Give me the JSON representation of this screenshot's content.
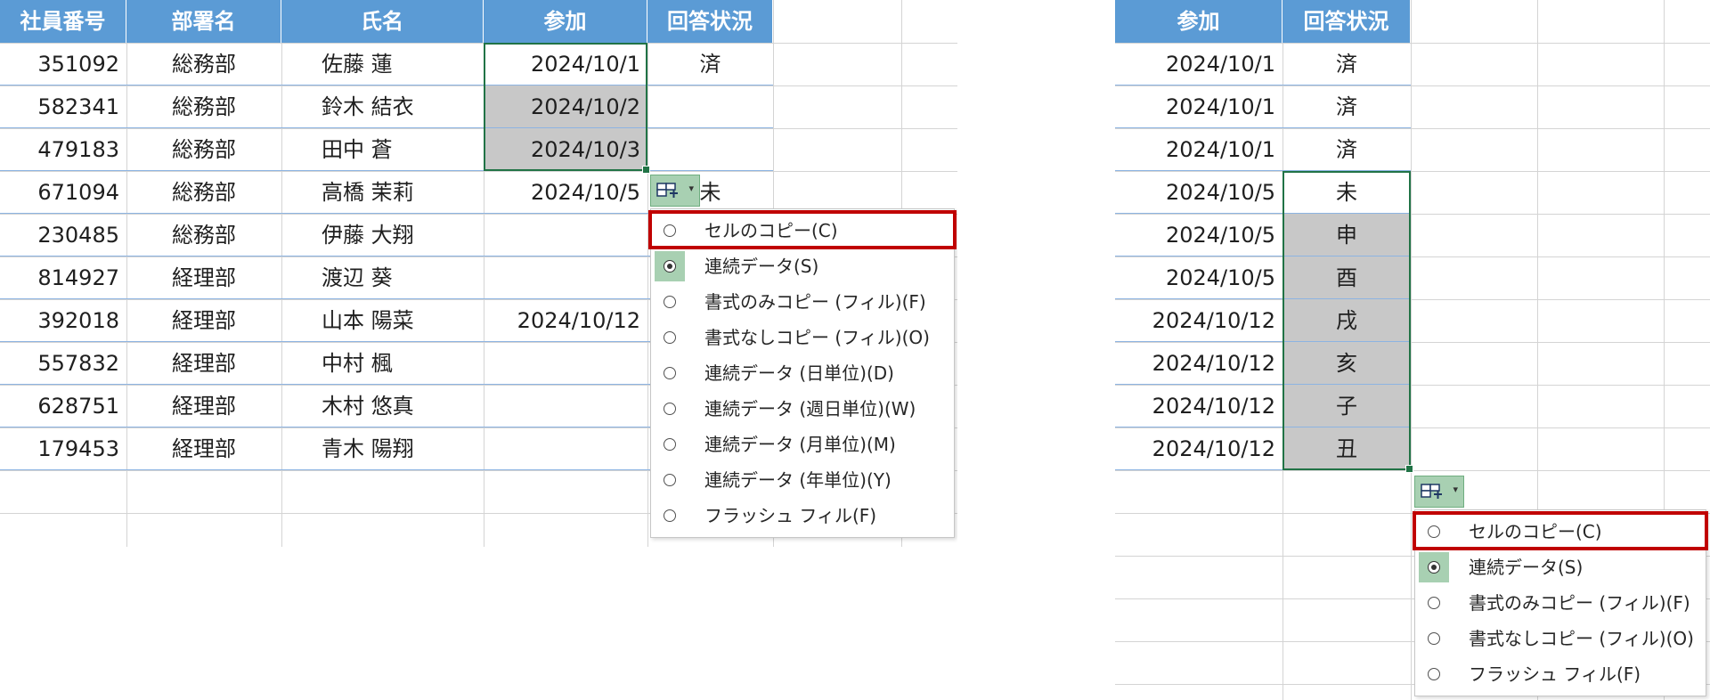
{
  "left_table": {
    "headers": [
      "社員番号",
      "部署名",
      "氏名",
      "参加",
      "回答状況"
    ],
    "rows": [
      [
        "351092",
        "総務部",
        "佐藤 蓮",
        "2024/10/1",
        "済"
      ],
      [
        "582341",
        "総務部",
        "鈴木 結衣",
        "2024/10/2",
        ""
      ],
      [
        "479183",
        "総務部",
        "田中 蒼",
        "2024/10/3",
        ""
      ],
      [
        "671094",
        "総務部",
        "高橋 茉莉",
        "2024/10/5",
        "未"
      ],
      [
        "230485",
        "総務部",
        "伊藤 大翔",
        "",
        ""
      ],
      [
        "814927",
        "経理部",
        "渡辺 葵",
        "",
        ""
      ],
      [
        "392018",
        "経理部",
        "山本 陽菜",
        "2024/10/12",
        ""
      ],
      [
        "557832",
        "経理部",
        "中村 楓",
        "",
        ""
      ],
      [
        "628751",
        "経理部",
        "木村 悠真",
        "",
        ""
      ],
      [
        "179453",
        "経理部",
        "青木 陽翔",
        "",
        ""
      ]
    ],
    "gray_rows": [
      1,
      2
    ],
    "selection_rows": [
      0,
      2
    ]
  },
  "left_menu": {
    "items": [
      "セルのコピー(C)",
      "連続データ(S)",
      "書式のみコピー (フィル)(F)",
      "書式なしコピー (フィル)(O)",
      "連続データ (日単位)(D)",
      "連続データ (週日単位)(W)",
      "連続データ (月単位)(M)",
      "連続データ (年単位)(Y)",
      "フラッシュ フィル(F)"
    ],
    "selected_index": 1,
    "highlighted_index": 0
  },
  "right_table": {
    "headers": [
      "参加",
      "回答状況"
    ],
    "rows": [
      [
        "2024/10/1",
        "済"
      ],
      [
        "2024/10/1",
        "済"
      ],
      [
        "2024/10/1",
        "済"
      ],
      [
        "2024/10/5",
        "未"
      ],
      [
        "2024/10/5",
        "申"
      ],
      [
        "2024/10/5",
        "酉"
      ],
      [
        "2024/10/12",
        "戌"
      ],
      [
        "2024/10/12",
        "亥"
      ],
      [
        "2024/10/12",
        "子"
      ],
      [
        "2024/10/12",
        "丑"
      ]
    ],
    "gray_rows": [
      4,
      5,
      6,
      7,
      8,
      9
    ],
    "selection_rows": [
      3,
      9
    ]
  },
  "right_menu": {
    "items": [
      "セルのコピー(C)",
      "連続データ(S)",
      "書式のみコピー (フィル)(F)",
      "書式なしコピー (フィル)(O)",
      "フラッシュ フィル(F)"
    ],
    "selected_index": 1,
    "highlighted_index": 0
  },
  "colors": {
    "header_bg": "#5b9bd5",
    "header_text": "#ffffff",
    "selection_border": "#217346",
    "fill_button_bg": "#a8d0b2",
    "highlight_box": "#c00000",
    "gray_cell": "#c8c8c8"
  },
  "icons": {
    "fill_options": "autofill-options-icon",
    "radio": "radio-icon"
  }
}
